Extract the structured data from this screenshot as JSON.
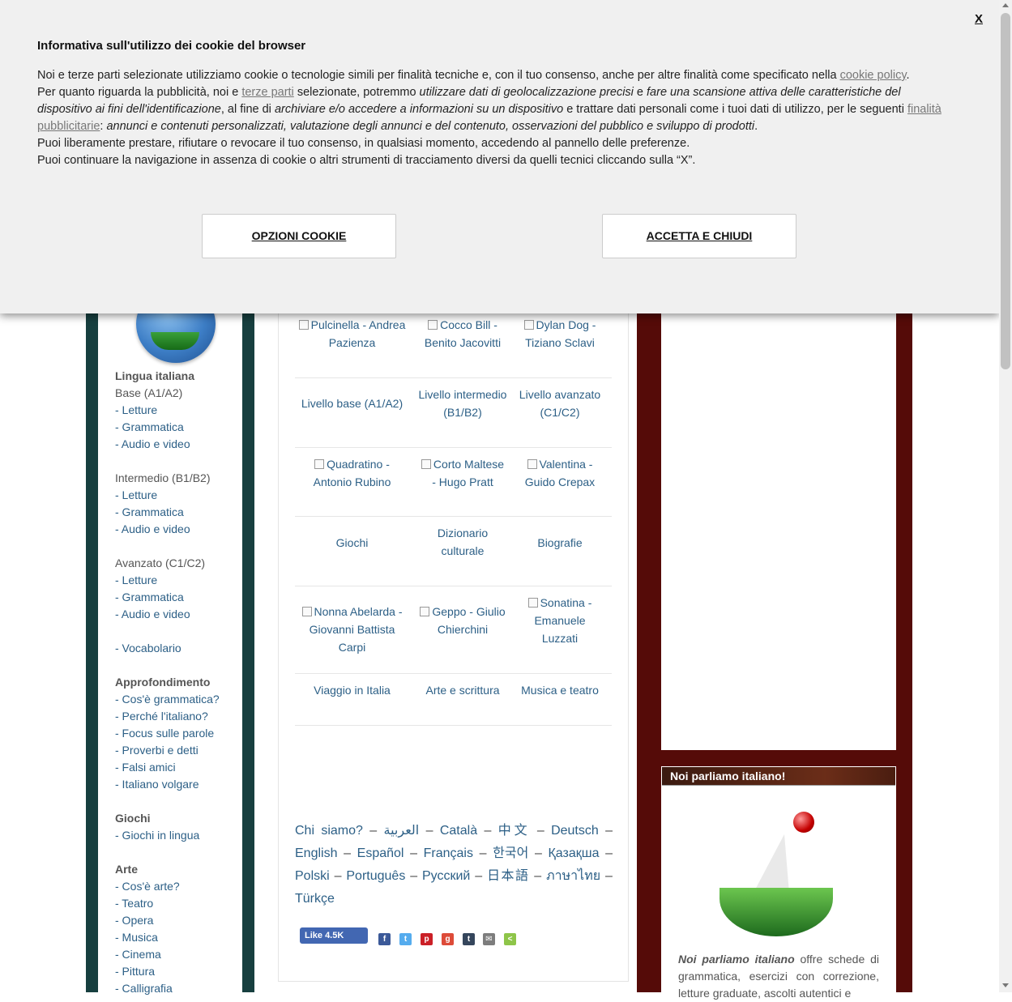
{
  "cookie": {
    "title": "Informativa sull'utilizzo dei cookie del browser",
    "close": "X",
    "p1_a": "Noi e terze parti selezionate utilizziamo cookie o tecnologie simili per finalità tecniche e, con il tuo consenso, anche per altre finalità come specificato nella ",
    "p1_link": "cookie policy",
    "p1_b": ".",
    "p2_a": "Per quanto riguarda la pubblicità, noi e ",
    "p2_link": "terze parti",
    "p2_b": " selezionate, potremmo ",
    "p2_i1": "utilizzare dati di geolocalizzazione precisi",
    "p2_c": " e ",
    "p2_i2": "fare una scansione attiva delle caratteristiche del dispositivo ai fini dell'identificazione",
    "p2_d": ", al fine di ",
    "p2_i3": "archiviare e/o accedere a informazioni su un dispositivo",
    "p2_e": " e trattare dati personali come i tuoi dati di utilizzo, per le seguenti ",
    "p2_link2": "finalità pubblicitarie",
    "p2_f": ": ",
    "p2_i4": "annunci e contenuti personalizzati, valutazione degli annunci e del contenuto, osservazioni del pubblico e sviluppo di prodotti",
    "p2_g": ".",
    "p3": "Puoi liberamente prestare, rifiutare o revocare il tuo consenso, in qualsiasi momento, accedendo al pannello delle preferenze.",
    "p4": "Puoi continuare la navigazione in assenza di cookie o altri strumenti di tracciamento diversi da quelli tecnici cliccando sulla “X”.",
    "btn_options": "OPZIONI COOKIE",
    "btn_accept": "ACCETTA E CHIUDI"
  },
  "nav": {
    "lingua": "Lingua italiana",
    "base": "Base (A1/A2)",
    "letture": "- Letture",
    "grammatica": "- Grammatica",
    "audio": "- Audio e video",
    "intermedio": "Intermedio (B1/B2)",
    "avanzato": "Avanzato (C1/C2)",
    "vocabolario": "- Vocabolario",
    "approfondimento": "Approfondimento",
    "cos_grammatica": "- Cos'è grammatica?",
    "perche": "- Perché l'italiano?",
    "focus": "- Focus sulle parole",
    "proverbi": "- Proverbi e detti",
    "falsi": "- Falsi amici",
    "volgare": "- Italiano volgare",
    "giochi_h": "Giochi",
    "giochi_lingua": "- Giochi in lingua",
    "arte_h": "Arte",
    "cos_arte": "- Cos'è arte?",
    "teatro": "- Teatro",
    "opera": "- Opera",
    "musica": "- Musica",
    "cinema": "- Cinema",
    "pittura": "- Pittura",
    "calligrafia": "- Calligrafia"
  },
  "grid": {
    "r1": [
      "Pulcinella - Andrea Pazienza",
      "Cocco Bill - Benito Jacovitti",
      "Dylan Dog - Tiziano Sclavi"
    ],
    "r2": [
      "Livello base (A1/A2)",
      "Livello intermedio (B1/B2)",
      "Livello avanzato (C1/C2)"
    ],
    "r3": [
      "Quadratino - Antonio Rubino",
      "Corto Maltese - Hugo Pratt",
      "Valentina - Guido Crepax"
    ],
    "r4": [
      "Giochi",
      "Dizionario culturale",
      "Biografie"
    ],
    "r5": [
      "Nonna Abelarda - Giovanni Battista Carpi",
      "Geppo - Giulio Chierchini",
      "Sonatina - Emanuele Luzzati"
    ],
    "r6": [
      "Viaggio in Italia",
      "Arte e scrittura",
      "Musica e teatro"
    ]
  },
  "langs": {
    "chi": "Chi siamo?",
    "ar": "العربية",
    "ca": "Català",
    "zh": "中文",
    "de": "Deutsch",
    "en": "English",
    "es": "Español",
    "fr": "Français",
    "ko": "한국어",
    "kk": "Қазақша",
    "pl": "Polski",
    "pt": "Português",
    "ru": "Русский",
    "ja": "日本語",
    "th": "ภาษาไทย",
    "tr": "Türkçe",
    "sep": "–"
  },
  "share": {
    "like": "Like 4.5K",
    "icons": [
      "facebook-icon",
      "twitter-icon",
      "pinterest-icon",
      "google-plus-icon",
      "tumblr-icon",
      "email-icon",
      "share-icon"
    ]
  },
  "noi": {
    "title": "Noi parliamo italiano!",
    "text_bold": "Noi parliamo italiano",
    "text": " offre schede di grammatica, esercizi con correzione, letture graduate, ascolti autentici e"
  },
  "colors": {
    "left_bar": "#173f3f",
    "right_bar": "#550b08",
    "link": "#2c5f86"
  }
}
